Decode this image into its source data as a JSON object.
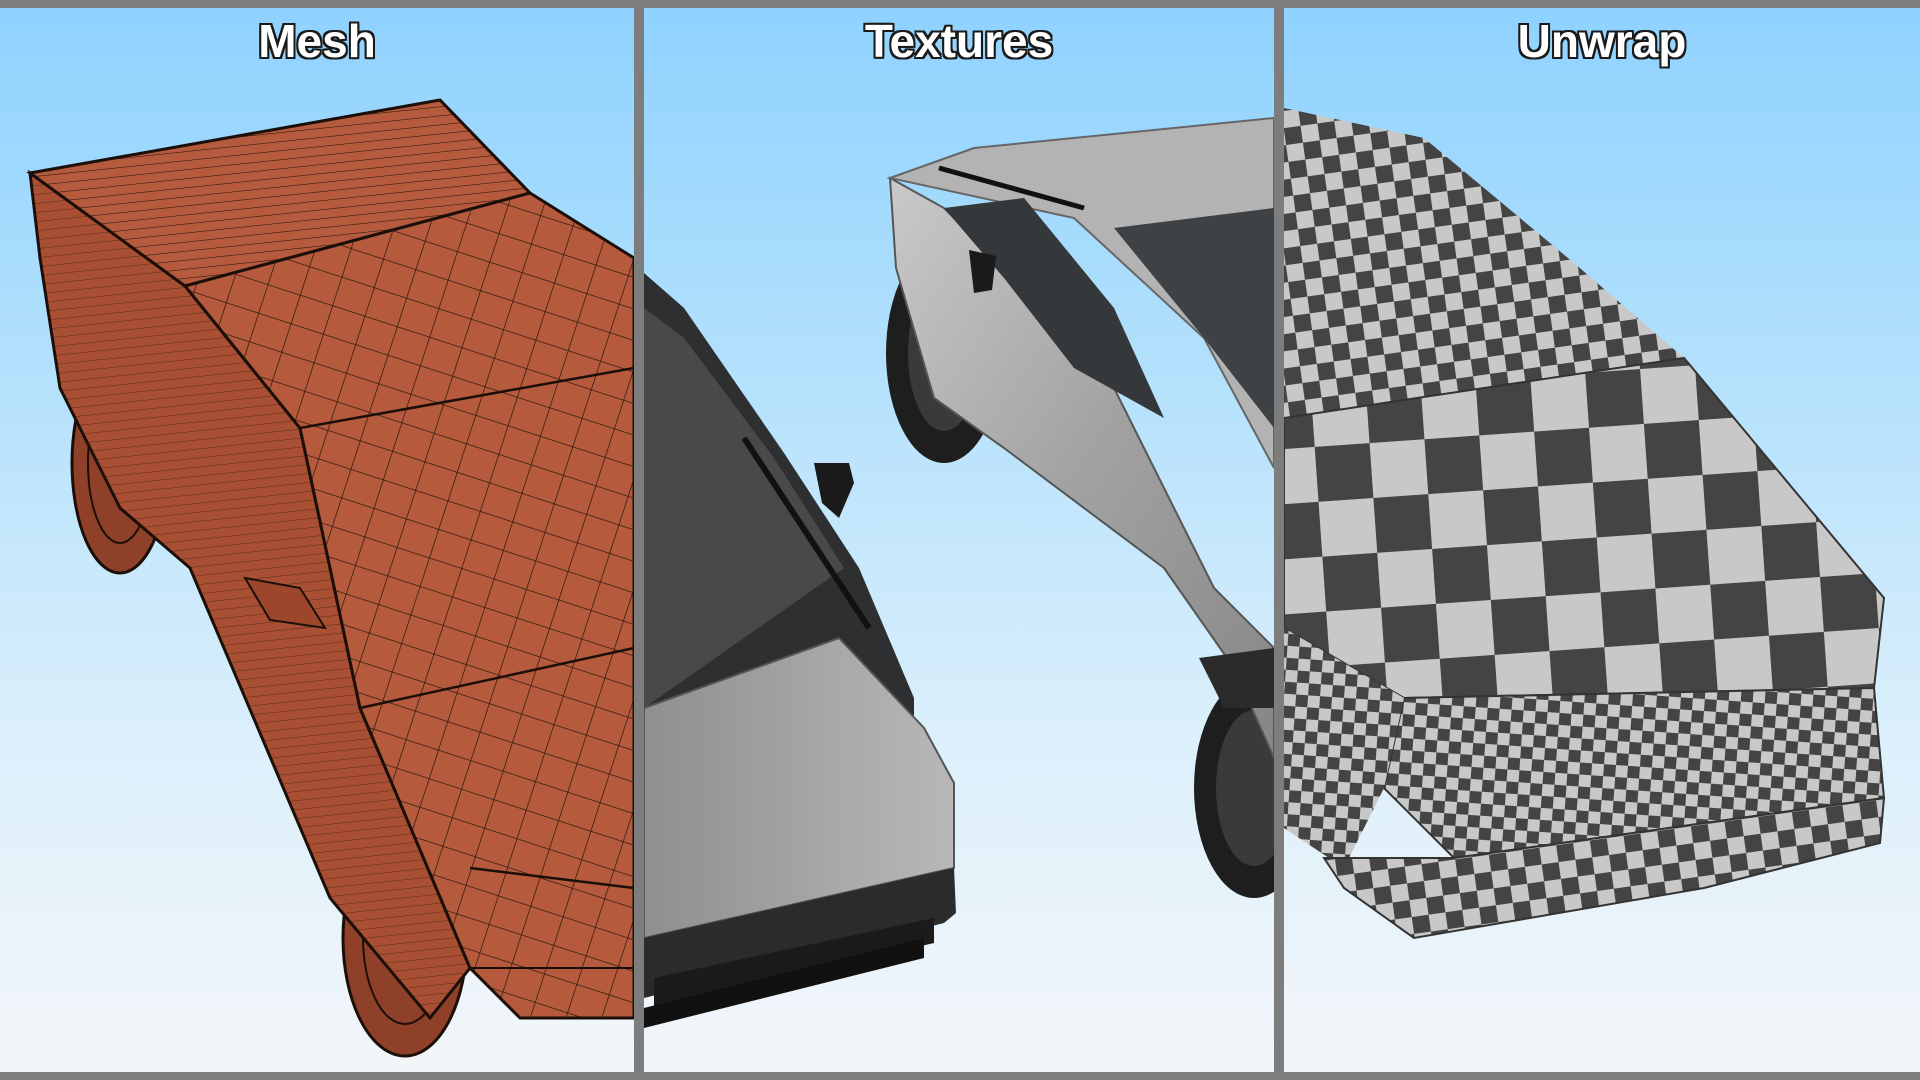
{
  "panels": [
    {
      "title": "Mesh",
      "body_color": "#b55a3c",
      "wire_color": "#1c0f09"
    },
    {
      "title": "Textures",
      "body_color": "#a4a4a4",
      "glass_color": "#3b3d3f"
    },
    {
      "title": "Unwrap",
      "checker_dark": "#444444",
      "checker_light": "#c8c8c8"
    }
  ],
  "colors": {
    "separator": "#7d7d7d",
    "sky_top": "#8fd2ff",
    "sky_bottom": "#f3f6f9"
  }
}
